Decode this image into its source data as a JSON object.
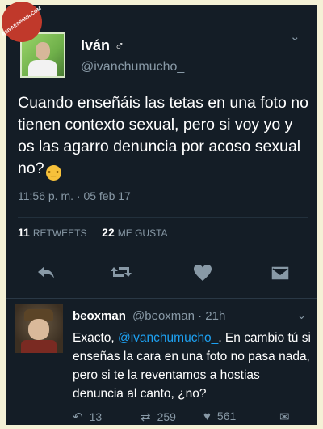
{
  "main_tweet": {
    "name": "Iván",
    "gender_symbol": "♂",
    "handle": "@ivanchumucho_",
    "text": "Cuando enseñáis las tetas en una foto no tienen contexto sexual, pero si voy yo y os las agarro denuncia por acoso sexual no?",
    "emoji": "😒",
    "timestamp": "11:56 p. m. · 05 feb 17",
    "retweets": {
      "count": "11",
      "label": "RETWEETS"
    },
    "likes": {
      "count": "22",
      "label": "ME GUSTA"
    },
    "icons": [
      "reply-icon",
      "retweet-icon",
      "heart-icon",
      "direct-message-icon"
    ]
  },
  "reply_tweet": {
    "name": "beoxman",
    "handle": "@beoxman",
    "time": "· 21h",
    "text_before": "Exacto, ",
    "mention": "@ivanchumucho_",
    "text_after": ". En cambio tú si enseñas la cara en una foto no pasa nada, pero si te la reventamos a hostias denuncia al canto, ¿no?",
    "replies": "13",
    "retweets": "259",
    "likes": "561"
  },
  "watermark": "ASIVAESPANA.COM",
  "colors": {
    "background": "#141d26",
    "outer": "#f4f1d6",
    "link": "#1da1f2",
    "muted": "#8899a6"
  }
}
